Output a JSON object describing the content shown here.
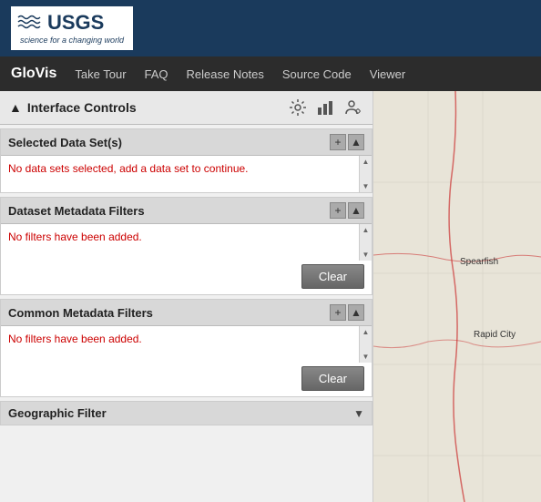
{
  "usgs": {
    "logo_text": "USGS",
    "tagline": "science for a changing world"
  },
  "nav": {
    "brand": "GloVis",
    "links": [
      "Take Tour",
      "FAQ",
      "Release Notes",
      "Source Code",
      "Viewer"
    ]
  },
  "interface_controls": {
    "title": "Interface Controls",
    "collapse_symbol": "▲"
  },
  "selected_datasets": {
    "title": "Selected Data Set(s)",
    "no_data_message": "No data sets selected, add a data set to continue."
  },
  "dataset_metadata": {
    "title": "Dataset Metadata Filters",
    "no_filter_message": "No filters have been added.",
    "clear_label": "Clear"
  },
  "common_metadata": {
    "title": "Common Metadata Filters",
    "no_filter_message": "No filters have been added.",
    "clear_label": "Clear"
  },
  "geographic_filter": {
    "title": "Geographic Filter",
    "dropdown_symbol": "▼"
  },
  "map": {
    "city_label": "Spearfish",
    "city2_label": "Rapid City"
  }
}
